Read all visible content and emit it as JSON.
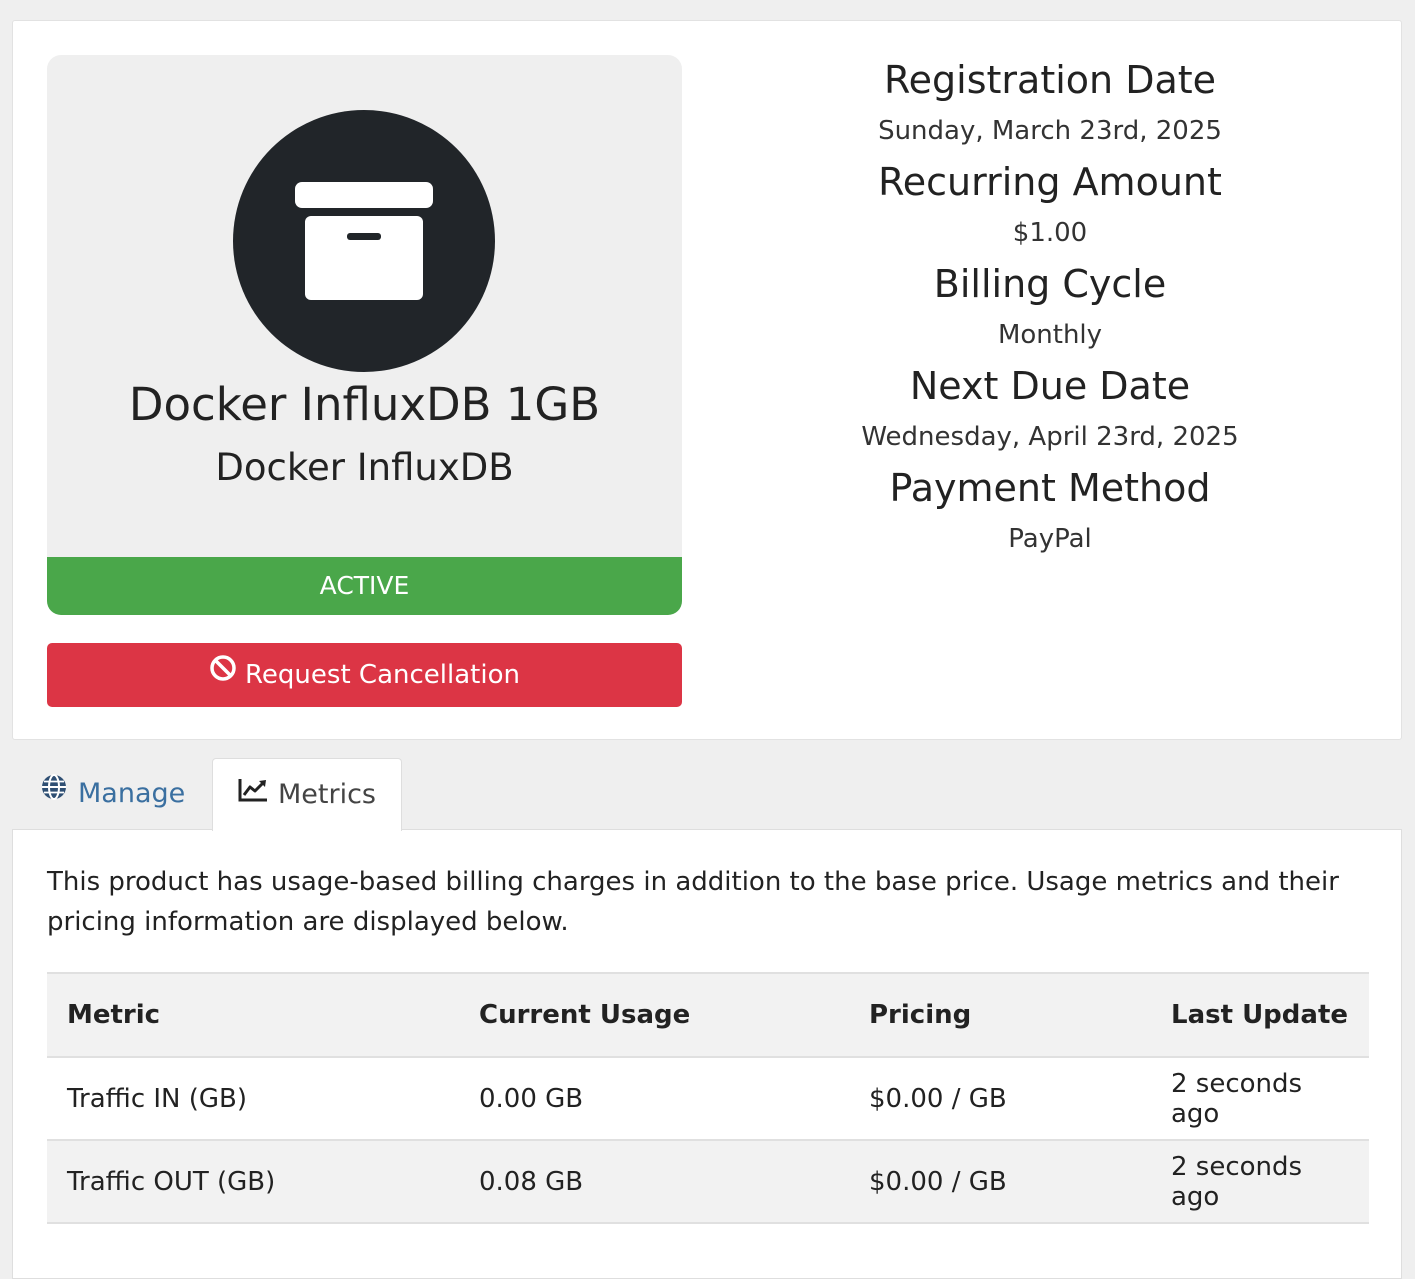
{
  "product": {
    "name": "Docker InfluxDB 1GB",
    "group": "Docker InfluxDB",
    "status": "ACTIVE",
    "icon": "archive-box-icon"
  },
  "actions": {
    "cancel_label": "Request Cancellation",
    "cancel_icon": "ban-icon"
  },
  "details": [
    {
      "heading": "Registration Date",
      "value": "Sunday, March 23rd, 2025"
    },
    {
      "heading": "Recurring Amount",
      "value": "$1.00"
    },
    {
      "heading": "Billing Cycle",
      "value": "Monthly"
    },
    {
      "heading": "Next Due Date",
      "value": "Wednesday, April 23rd, 2025"
    },
    {
      "heading": "Payment Method",
      "value": "PayPal"
    }
  ],
  "tabs": [
    {
      "label": "Manage",
      "icon": "globe-icon",
      "active": false
    },
    {
      "label": "Metrics",
      "icon": "line-chart-icon",
      "active": true
    }
  ],
  "metrics": {
    "description": "This product has usage-based billing charges in addition to the base price. Usage metrics and their pricing information are displayed below.",
    "columns": [
      "Metric",
      "Current Usage",
      "Pricing",
      "Last Update"
    ],
    "rows": [
      [
        "Traffic IN (GB)",
        "0.00 GB",
        "$0.00 / GB",
        "2 seconds ago"
      ],
      [
        "Traffic OUT (GB)",
        "0.08 GB",
        "$0.00 / GB",
        "2 seconds ago"
      ]
    ]
  },
  "colors": {
    "status_active": "#4aa74a",
    "danger": "#dc3545",
    "link": "#3a6fa0",
    "icon_circle": "#212529"
  }
}
